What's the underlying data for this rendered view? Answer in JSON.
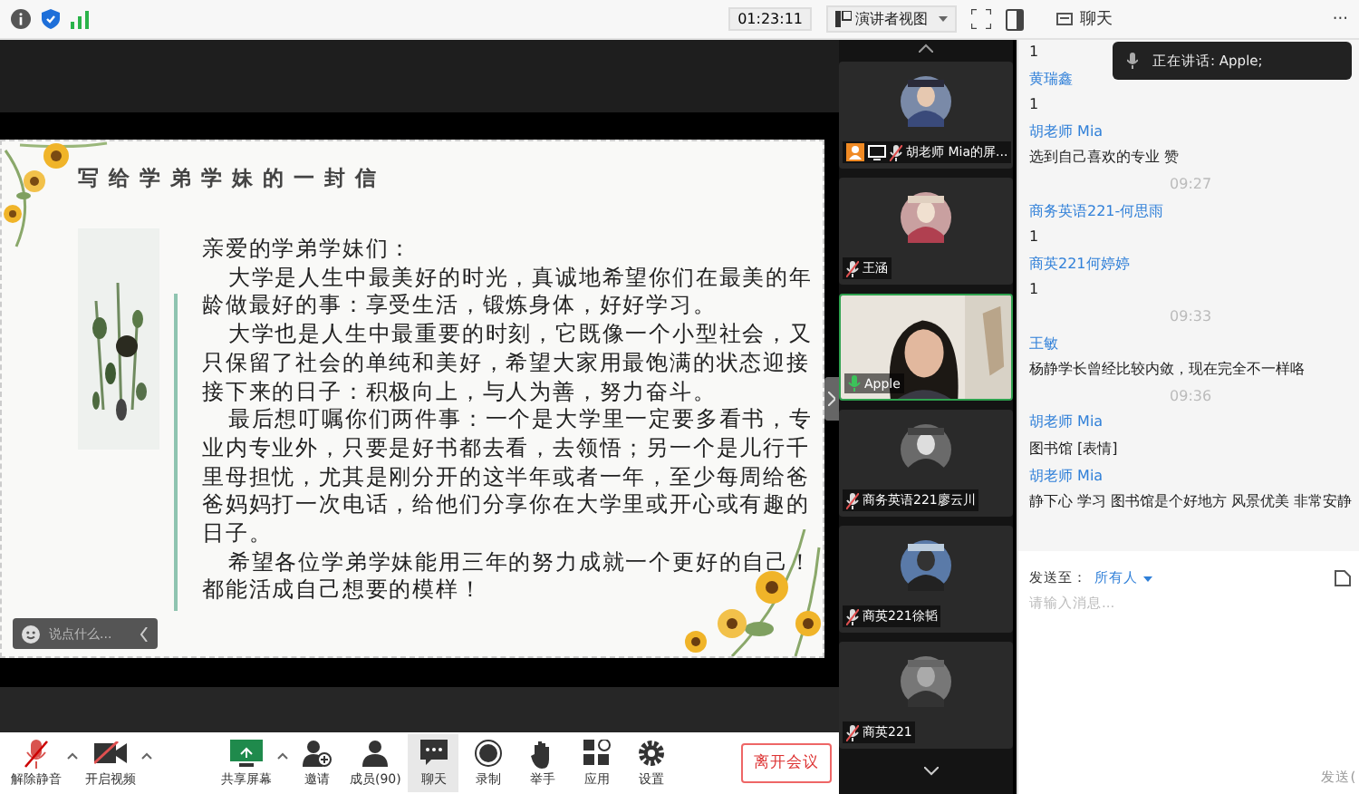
{
  "top_bar": {
    "timer": "01:23:11",
    "view_button": "演讲者视图"
  },
  "slide": {
    "title": "写给学弟学妹的一封信",
    "greeting": "亲爱的学弟学妹们：",
    "paragraphs": [
      "大学是人生中最美好的时光，真诚地希望你们在最美的年龄做最好的事：享受生活，锻炼身体，好好学习。",
      "大学也是人生中最重要的时刻，它既像一个小型社会，又只保留了社会的单纯和美好，希望大家用最饱满的状态迎接接下来的日子：积极向上，与人为善，努力奋斗。",
      "最后想叮嘱你们两件事：一个是大学里一定要多看书，专业内专业外，只要是好书都去看，去领悟；另一个是儿行千里母担忧，尤其是刚分开的这半年或者一年，至少每周给爸爸妈妈打一次电话，给他们分享你在大学里或开心或有趣的日子。",
      "希望各位学弟学妹能用三年的努力成就一个更好的自己！都能活成自己想要的模样！"
    ],
    "comment_placeholder": "说点什么..."
  },
  "participants": [
    {
      "name": "胡老师 Mia的屏...",
      "kind": "avatar",
      "speaking": false,
      "sharing": true
    },
    {
      "name": "王涵",
      "kind": "avatar",
      "speaking": false,
      "sharing": false
    },
    {
      "name": "Apple",
      "kind": "video",
      "speaking": true,
      "sharing": false
    },
    {
      "name": "商务英语221廖云川",
      "kind": "avatar",
      "speaking": false,
      "sharing": false
    },
    {
      "name": "商英221徐韬",
      "kind": "avatar",
      "speaking": false,
      "sharing": false
    },
    {
      "name": "商英221",
      "kind": "avatar",
      "speaking": false,
      "sharing": false
    }
  ],
  "chat": {
    "title": "聊天",
    "more": "···",
    "speaking_toast": "正在讲话: Apple;",
    "messages": [
      {
        "kind": "text",
        "text": "1"
      },
      {
        "kind": "sender",
        "text": "黄瑞鑫"
      },
      {
        "kind": "text",
        "text": "1"
      },
      {
        "kind": "sender",
        "text": "胡老师 Mia"
      },
      {
        "kind": "text",
        "text": "选到自己喜欢的专业 赞"
      },
      {
        "kind": "time",
        "text": "09:27"
      },
      {
        "kind": "sender",
        "text": "商务英语221-何思雨"
      },
      {
        "kind": "text",
        "text": "1"
      },
      {
        "kind": "sender",
        "text": "商英221何婷婷"
      },
      {
        "kind": "text",
        "text": "1"
      },
      {
        "kind": "time",
        "text": "09:33"
      },
      {
        "kind": "sender",
        "text": "王敏"
      },
      {
        "kind": "text",
        "text": "杨静学长曾经比较内敛，现在完全不一样咯"
      },
      {
        "kind": "time",
        "text": "09:36"
      },
      {
        "kind": "sender",
        "text": "胡老师 Mia"
      },
      {
        "kind": "text",
        "text": "图书馆 [表情]"
      },
      {
        "kind": "sender",
        "text": "胡老师 Mia"
      },
      {
        "kind": "text",
        "text": "静下心 学习 图书馆是个好地方 风景优美 非常安静"
      }
    ],
    "send_to_label": "发送至：",
    "recipient": "所有人",
    "placeholder": "请输入消息...",
    "send_button": "发送("
  },
  "toolbar": [
    {
      "kind": "mic",
      "label": "解除静音",
      "selected": false,
      "caret": true
    },
    {
      "kind": "camera",
      "label": "开启视频",
      "selected": false,
      "caret": true
    },
    {
      "kind": "share",
      "label": "共享屏幕",
      "selected": false,
      "caret": true
    },
    {
      "kind": "invite",
      "label": "邀请",
      "selected": false,
      "caret": false
    },
    {
      "kind": "members",
      "label": "成员(90)",
      "selected": false,
      "caret": false
    },
    {
      "kind": "chat",
      "label": "聊天",
      "selected": true,
      "caret": false
    },
    {
      "kind": "record",
      "label": "录制",
      "selected": false,
      "caret": false
    },
    {
      "kind": "hand",
      "label": "举手",
      "selected": false,
      "caret": false
    },
    {
      "kind": "apps",
      "label": "应用",
      "selected": false,
      "caret": false
    },
    {
      "kind": "settings",
      "label": "设置",
      "selected": false,
      "caret": false
    }
  ],
  "leave_button": "离开会议"
}
